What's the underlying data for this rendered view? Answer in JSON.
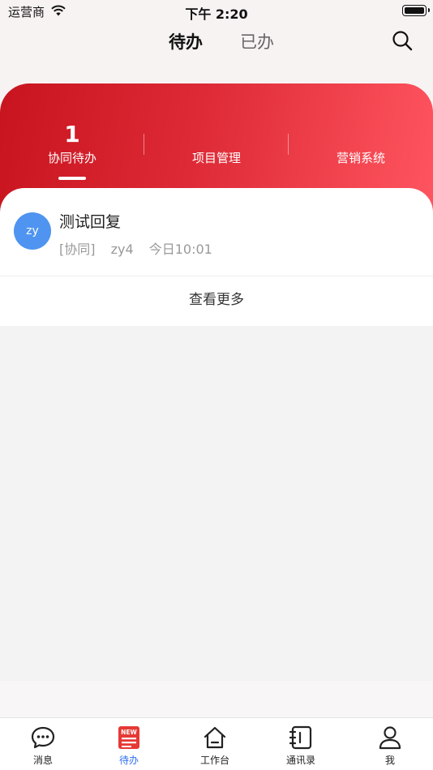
{
  "status_bar": {
    "carrier": "运营商",
    "time": "下午 2:20"
  },
  "header": {
    "tabs": [
      {
        "label": "待办",
        "active": true
      },
      {
        "label": "已办",
        "active": false
      }
    ]
  },
  "summary": {
    "columns": [
      {
        "count": "1",
        "label": "协同待办",
        "selected": true
      },
      {
        "count": "",
        "label": "项目管理",
        "selected": false
      },
      {
        "count": "",
        "label": "营销系统",
        "selected": false
      }
    ]
  },
  "list": {
    "items": [
      {
        "avatar_text": "zy",
        "title": "测试回复",
        "category": "[协同]",
        "sender": "zy4",
        "time": "今日10:01"
      }
    ],
    "more_label": "查看更多"
  },
  "tabbar": {
    "items": [
      {
        "label": "消息",
        "icon": "chat-bubble-icon"
      },
      {
        "label": "待办",
        "icon": "new-badge-icon",
        "badge": "NEW",
        "active": true
      },
      {
        "label": "工作台",
        "icon": "home-icon"
      },
      {
        "label": "通讯录",
        "icon": "contacts-book-icon"
      },
      {
        "label": "我",
        "icon": "user-icon"
      }
    ]
  },
  "colors": {
    "accent_red": "#dd2a36",
    "gradient_end": "#ff5560",
    "active_blue": "#2f6ef0",
    "avatar_blue": "#4e94f0"
  }
}
